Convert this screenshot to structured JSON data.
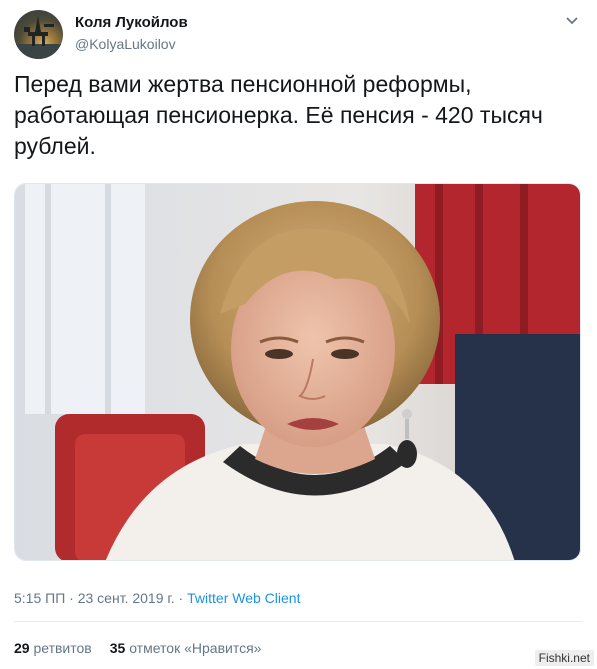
{
  "author": {
    "name": "Коля Лукойлов",
    "handle": "@KolyaLukoilov"
  },
  "tweet": {
    "text": "Перед вами жертва пенсионной реформы,\nработающая пенсионерка. Её пенсия - 420 тысяч\nрублей."
  },
  "meta": {
    "time": "5:15 ПП",
    "separator1": " · ",
    "date": "23 сент. 2019 г.",
    "separator2": " · ",
    "client": "Twitter Web Client"
  },
  "stats": {
    "retweets_count": "29",
    "retweets_label": "ретвитов",
    "likes_count": "35",
    "likes_label": "отметок «Нравится»"
  },
  "watermark": "Fishki.net",
  "colors": {
    "link": "#1b95e0",
    "secondary_text": "#657786"
  },
  "icons": {
    "menu": "chevron-down-icon"
  }
}
